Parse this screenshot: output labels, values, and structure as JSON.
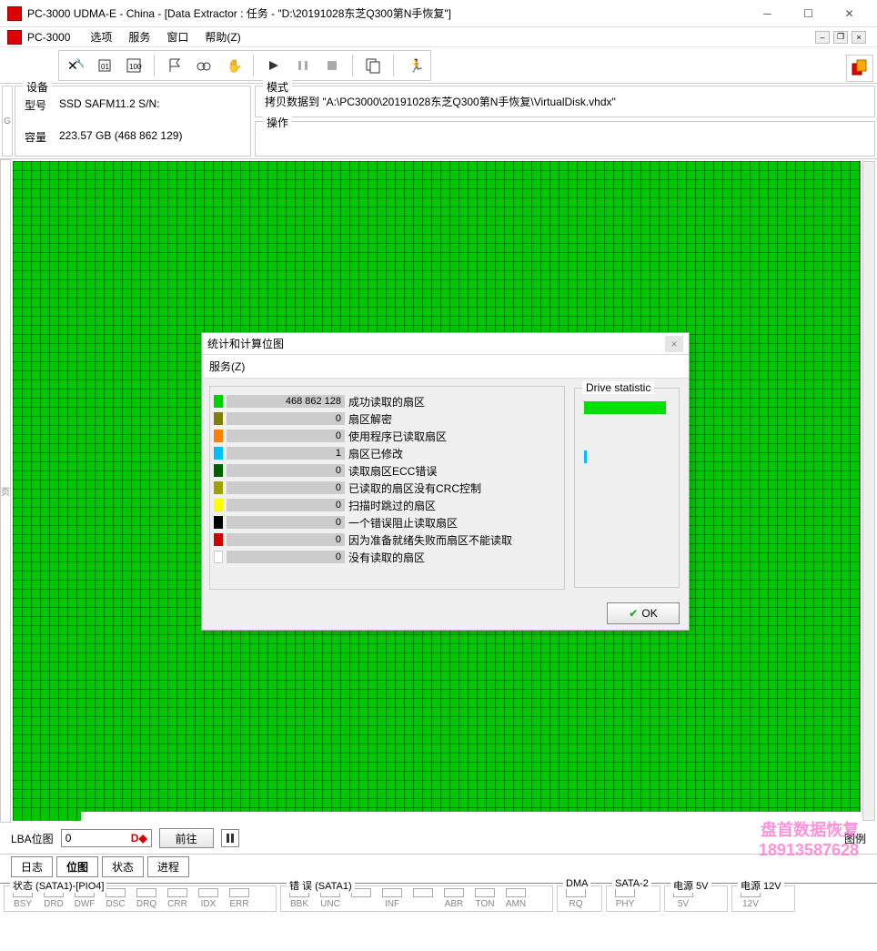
{
  "title": "PC-3000 UDMA-E - China - [Data Extractor : 任务 - \"D:\\20191028东芝Q300第N手恢复\"]",
  "menubar": {
    "app": "PC-3000",
    "items": [
      "选项",
      "服务",
      "窗口",
      "帮助(Z)"
    ]
  },
  "device": {
    "legend": "设备",
    "model_label": "型号",
    "model_value": "SSD SAFM11.2 S/N:",
    "capacity_label": "容量",
    "capacity_value": "223.57 GB (468 862 129)"
  },
  "mode": {
    "legend": "模式",
    "value": "拷贝数据到 \"A:\\PC3000\\20191028东芝Q300第N手恢复\\VirtualDisk.vhdx\"",
    "op_legend": "操作"
  },
  "dialog": {
    "title": "统计和计算位图",
    "menu": "服务(Z)",
    "drive_stat": "Drive statistic",
    "ok": "OK",
    "stats": [
      {
        "color": "#00d000",
        "value": "468 862 128",
        "label": "成功读取的扇区"
      },
      {
        "color": "#808000",
        "value": "0",
        "label": "扇区解密"
      },
      {
        "color": "#ff8000",
        "value": "0",
        "label": "使用程序已读取扇区"
      },
      {
        "color": "#00bfff",
        "value": "1",
        "label": "扇区已修改"
      },
      {
        "color": "#006000",
        "value": "0",
        "label": "读取扇区ECC错误"
      },
      {
        "color": "#a0a000",
        "value": "0",
        "label": "已读取的扇区没有CRC控制"
      },
      {
        "color": "#ffff00",
        "value": "0",
        "label": "扫描时跳过的扇区"
      },
      {
        "color": "#000000",
        "value": "0",
        "label": "一个错误阻止读取扇区"
      },
      {
        "color": "#d00000",
        "value": "0",
        "label": "因为准备就绪失败而扇区不能读取"
      },
      {
        "color": "#ffffff",
        "value": "0",
        "label": "没有读取的扇区"
      }
    ]
  },
  "lba": {
    "label": "LBA位图",
    "value": "0",
    "go": "前往",
    "legend": "图例"
  },
  "tabs": [
    "日志",
    "位图",
    "状态",
    "进程"
  ],
  "status": {
    "g1": {
      "legend": "状态 (SATA1)-[PIO4]",
      "leds": [
        "BSY",
        "DRD",
        "DWF",
        "DSC",
        "DRQ",
        "CRR",
        "IDX",
        "ERR"
      ]
    },
    "g2": {
      "legend": "错 误 (SATA1)",
      "leds": [
        "BBK",
        "UNC",
        "",
        "INF",
        "",
        "ABR",
        "TON",
        "AMN"
      ]
    },
    "g3": {
      "legend": "DMA",
      "leds": [
        "RQ"
      ]
    },
    "g4": {
      "legend": "SATA-2",
      "leds": [
        "PHY"
      ]
    },
    "g5": {
      "legend": "电源 5V",
      "leds": [
        "5V"
      ]
    },
    "g6": {
      "legend": "电源 12V",
      "leds": [
        "12V"
      ]
    }
  },
  "watermark": {
    "line1": "盘首数据恢复",
    "line2": "18913587628"
  }
}
